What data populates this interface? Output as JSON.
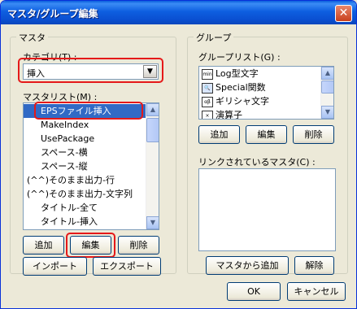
{
  "window": {
    "title": "マスタ/グループ編集",
    "close": "✕"
  },
  "master": {
    "group_label": "マスタ",
    "category_label": "カテゴリ(T) :",
    "category_value": "挿入",
    "list_label": "マスタリスト(M) :",
    "items": [
      "EPSファイル挿入",
      "MakeIndex",
      "UsePackage",
      "スペース-横",
      "スペース-縦",
      "(^^)そのまま出力-行",
      "(^^)そのまま出力-文字列",
      "タイトル-全て",
      "タイトル-挿入"
    ],
    "buttons": {
      "add": "追加",
      "edit": "編集",
      "delete": "削除",
      "import": "インポート",
      "export": "エクスポート"
    }
  },
  "group": {
    "group_label": "グループ",
    "list_label": "グループリスト(G) :",
    "items": [
      {
        "icon": "min",
        "label": "Log型文字"
      },
      {
        "icon": "search",
        "label": "Special関数"
      },
      {
        "icon": "ab",
        "label": "ギリシャ文字"
      },
      {
        "icon": "x",
        "label": "演算子"
      }
    ],
    "buttons": {
      "add": "追加",
      "edit": "編集",
      "delete": "削除"
    },
    "linked_label": "リンクされているマスタ(C) :",
    "add_from_master": "マスタから追加",
    "unlink": "解除"
  },
  "footer": {
    "ok": "OK",
    "cancel": "キャンセル"
  }
}
